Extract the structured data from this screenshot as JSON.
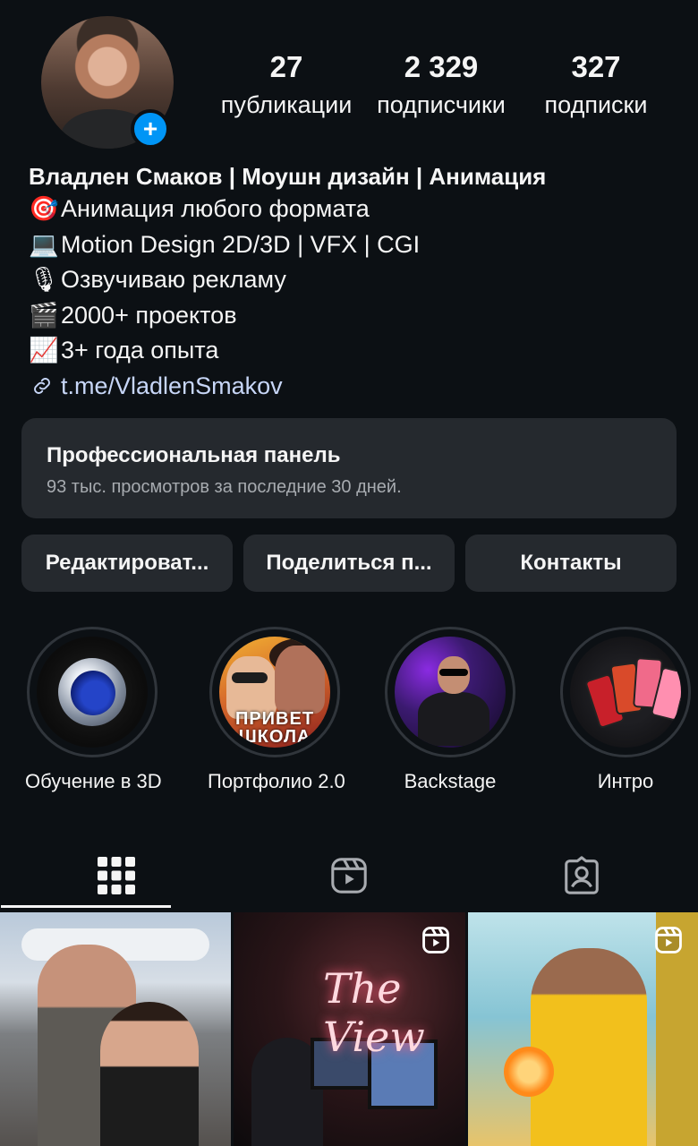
{
  "profile": {
    "stats": {
      "posts_count": "27",
      "posts_label": "публикации",
      "followers_count": "2 329",
      "followers_label": "подписчики",
      "following_count": "327",
      "following_label": "подписки"
    },
    "add_badge_symbol": "+",
    "bio": {
      "name": "Владлен Смаков | Моушн дизайн | Анимация",
      "lines": [
        {
          "icon": "🎯",
          "icon_name": "target-icon",
          "text": "Анимация любого формата"
        },
        {
          "icon": "💻",
          "icon_name": "laptop-icon",
          "text": "Motion Design 2D/3D | VFX | CGI"
        },
        {
          "icon": "🎙",
          "icon_name": "microphone-icon",
          "text": "Озвучиваю рекламу"
        },
        {
          "icon": "🎬",
          "icon_name": "clapper-icon",
          "text": "2000+ проектов"
        },
        {
          "icon": "📈",
          "icon_name": "chart-icon",
          "text": "3+ года опыта"
        }
      ],
      "link": "t.me/VladlenSmakov"
    }
  },
  "pro_panel": {
    "title": "Профессиональная панель",
    "subtitle": "93 тыс. просмотров за последние 30 дней."
  },
  "buttons": {
    "edit": "Редактироват...",
    "share": "Поделиться п...",
    "contacts": "Контакты"
  },
  "highlights": [
    {
      "label": "Обучение в 3D"
    },
    {
      "label": "Портфолио 2.0",
      "art_text": "ПРИВЕТ ШКОЛА"
    },
    {
      "label": "Backstage"
    },
    {
      "label": "Интро"
    }
  ],
  "posts": [
    {
      "is_reel": false
    },
    {
      "is_reel": true,
      "art_text": "The View"
    },
    {
      "is_reel": true
    }
  ],
  "colors": {
    "background": "#0c1014",
    "card": "#25292e",
    "accent_blue": "#0095f6",
    "link": "#c7d6f7"
  }
}
